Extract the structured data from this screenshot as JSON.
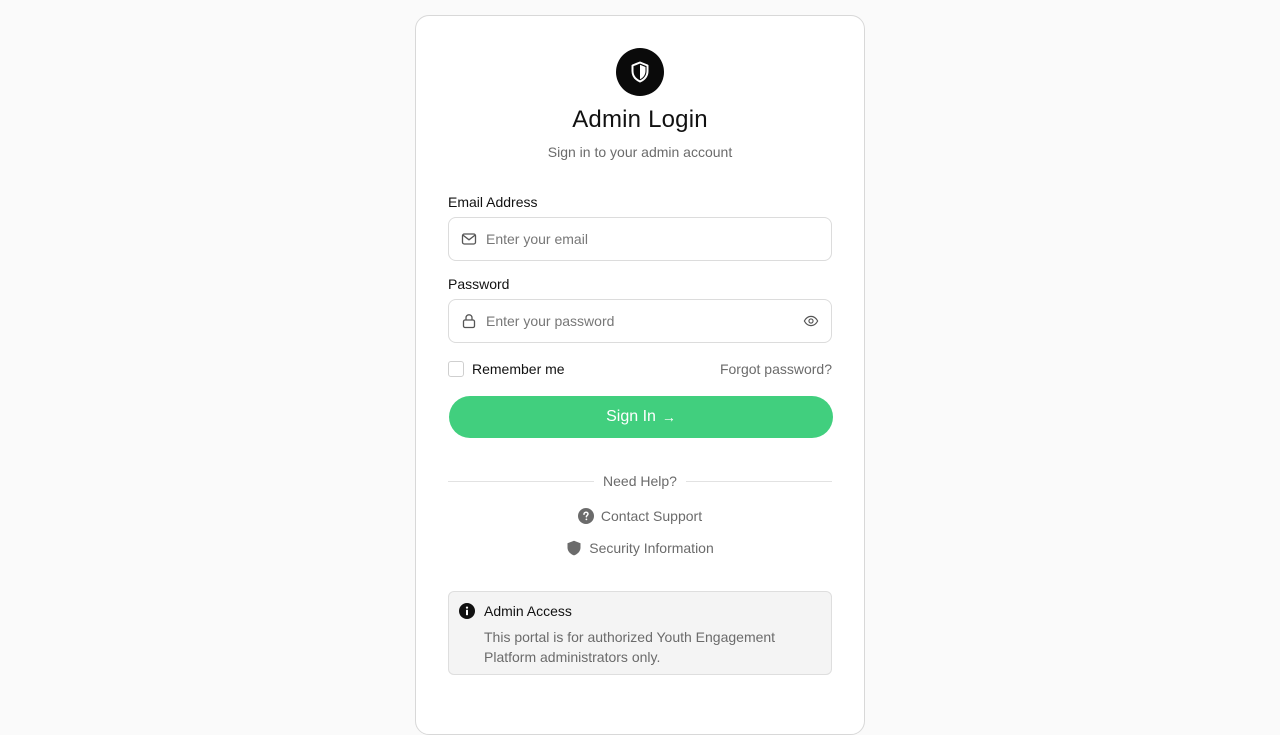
{
  "header": {
    "logo_icon": "shield-icon",
    "title": "Admin Login",
    "subtitle": "Sign in to your admin account"
  },
  "form": {
    "email_label": "Email Address",
    "email_placeholder": "Enter your email",
    "email_value": "",
    "email_icon": "mail-icon",
    "password_label": "Password",
    "password_placeholder": "Enter your password",
    "password_value": "",
    "password_icon": "lock-icon",
    "toggle_icon": "eye-icon",
    "remember_label": "Remember me",
    "remember_checked": false,
    "forgot_label": "Forgot password?",
    "submit_label": "Sign In",
    "submit_arrow": "→"
  },
  "help": {
    "divider_label": "Need Help?",
    "links": [
      {
        "label": "Contact Support",
        "icon": "question-circle-icon"
      },
      {
        "label": "Security Information",
        "icon": "shield-icon"
      }
    ]
  },
  "notice": {
    "icon": "info-icon",
    "title": "Admin Access",
    "text": "This portal is for authorized Youth Engagement Platform administrators only."
  },
  "colors": {
    "accent": "#41cf7e",
    "logo_bg": "#0a0a0a",
    "muted_text": "#6b6b6b",
    "page_bg": "#fafafa"
  }
}
